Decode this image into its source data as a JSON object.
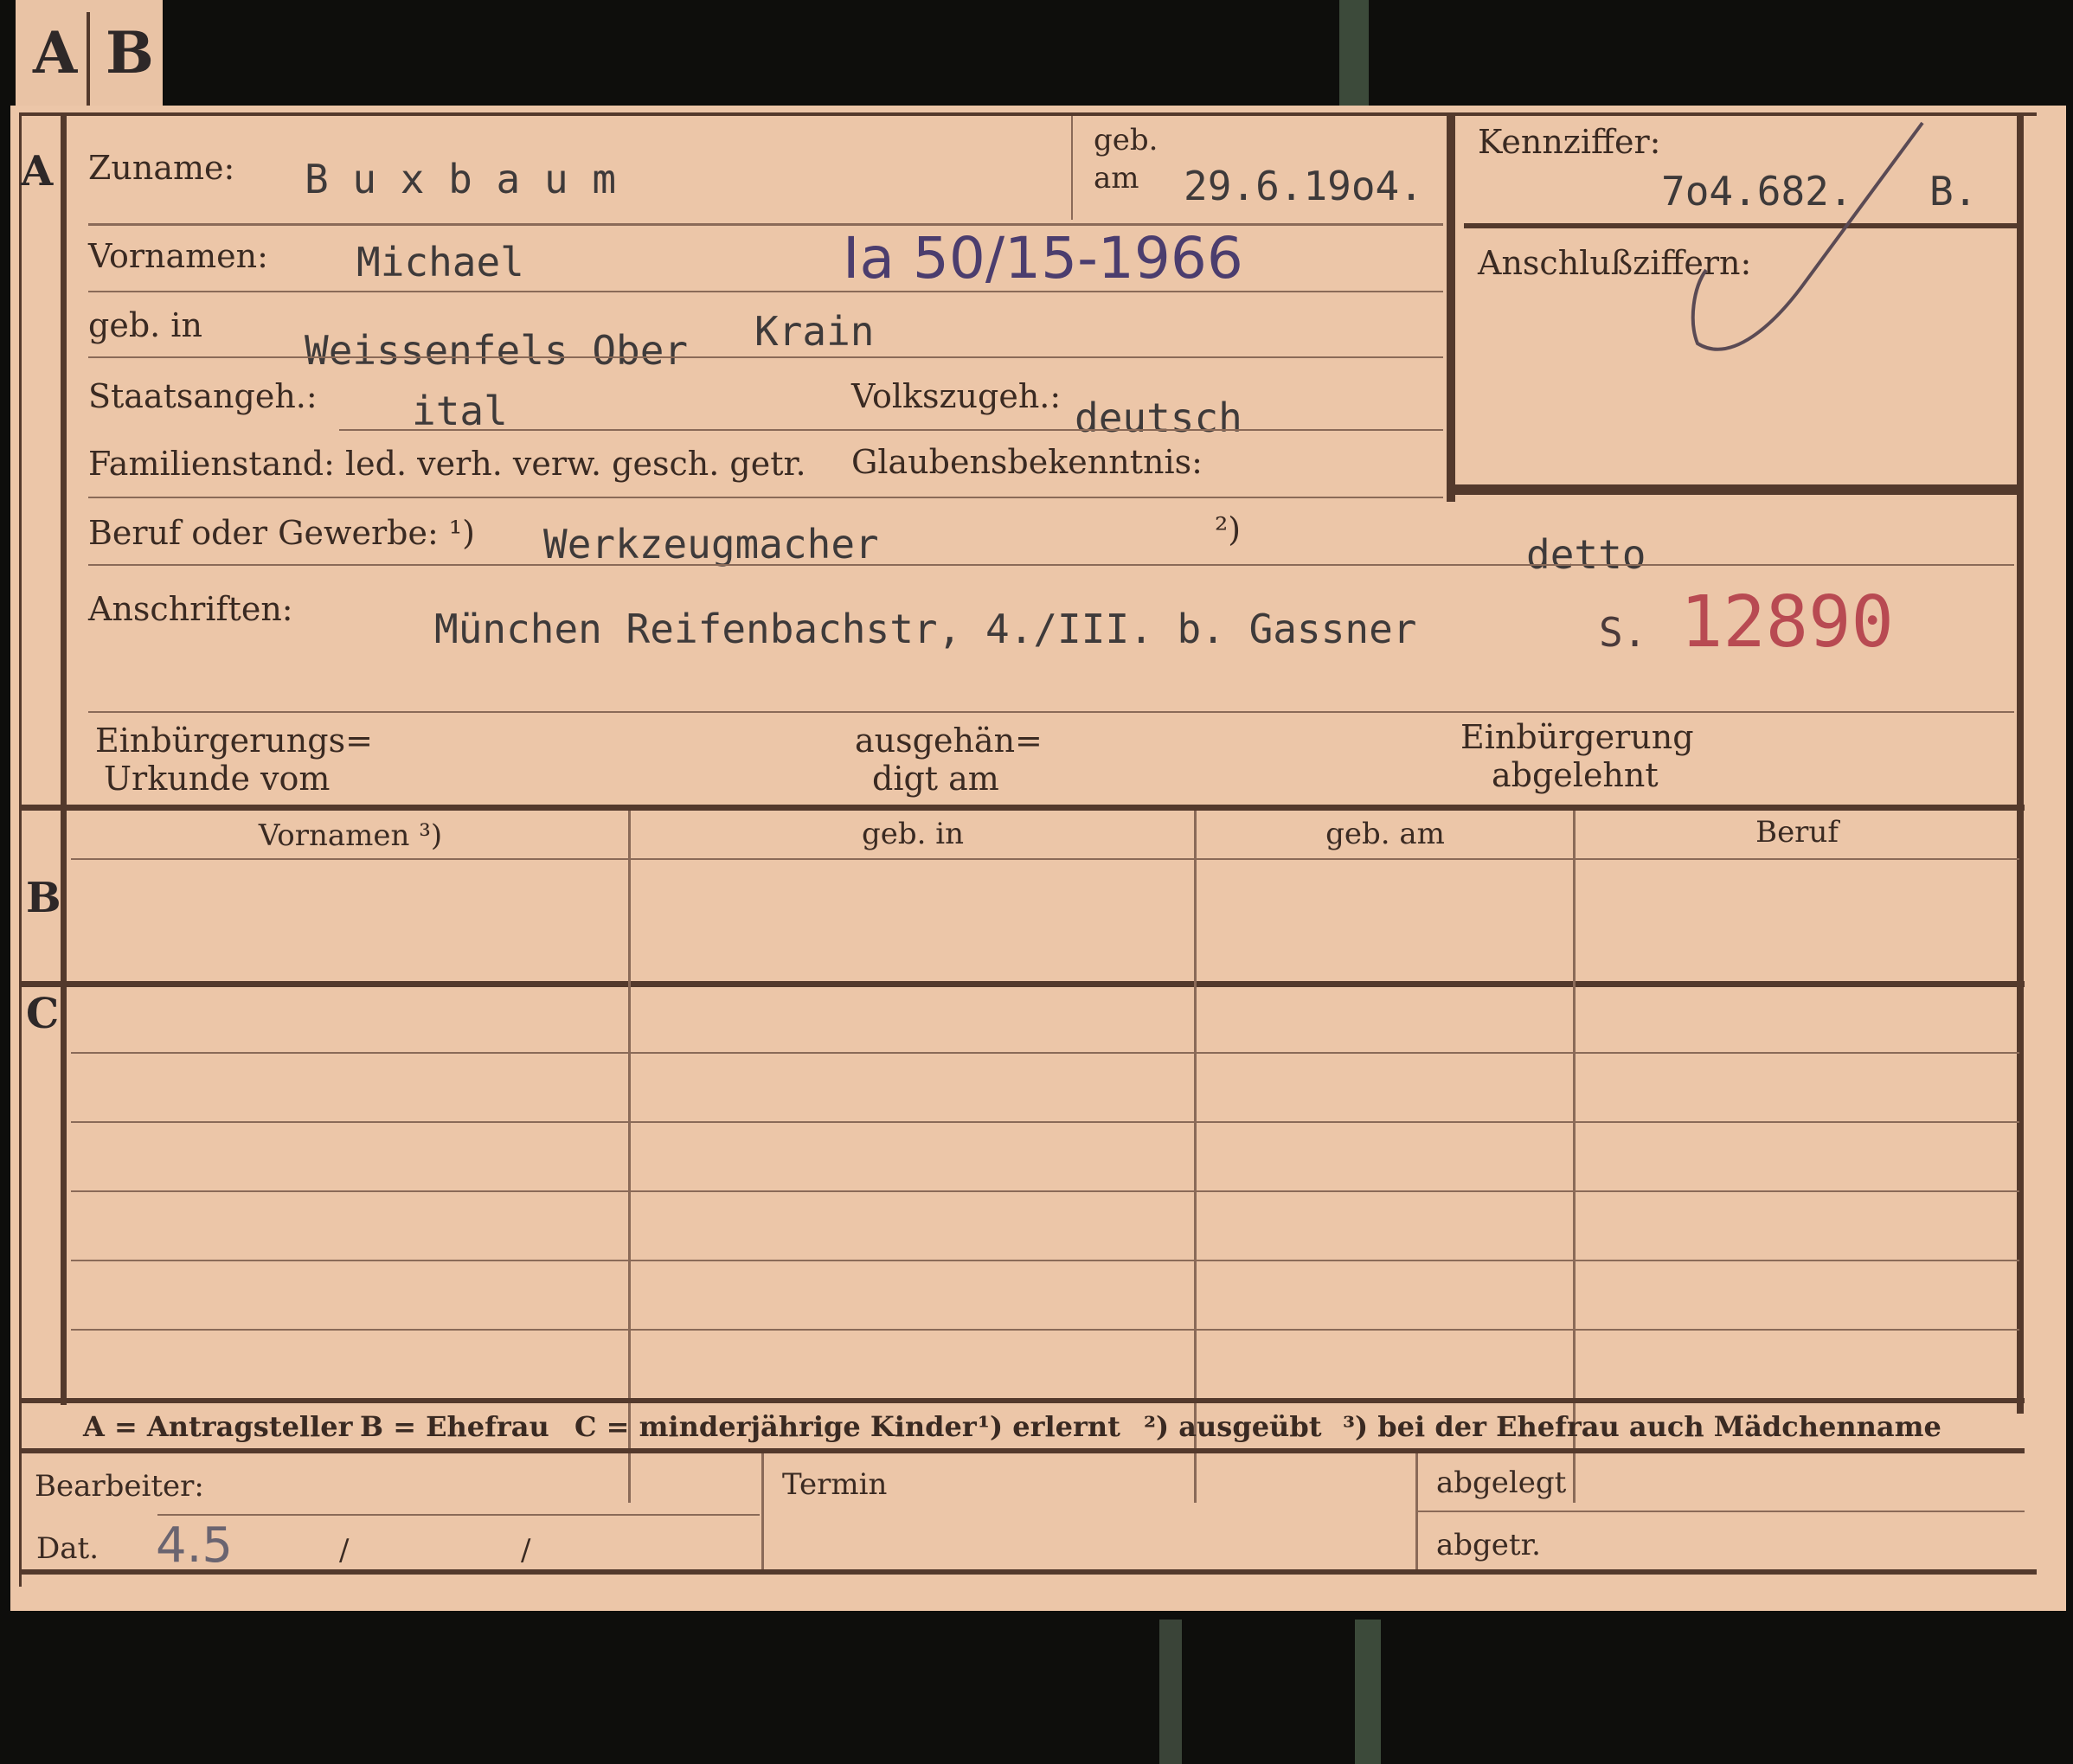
{
  "tab": {
    "a": "A",
    "b": "B"
  },
  "sections": {
    "a": "A",
    "b": "B",
    "c": "C"
  },
  "labels": {
    "zuname": "Zuname:",
    "geb": "geb.",
    "am": "am",
    "kennziffer": "Kennziffer:",
    "anschlussziffern": "Anschlußziffern:",
    "vornamen": "Vornamen:",
    "geb_in": "geb. in",
    "staatsangeh": "Staatsangeh.:",
    "volkszugeh": "Volkszugeh.:",
    "familienstand": "Familienstand: led. verh. verw. gesch. getr.",
    "glaubensbekenntnis": "Glaubensbekenntnis:",
    "beruf": "Beruf oder Gewerbe: ¹)",
    "beruf_note2": "²)",
    "anschriften": "Anschriften:",
    "einbuergerungs_line1": "Einbürgerungs=",
    "einbuergerungs_line2": "Urkunde vom",
    "ausgehaen_line1": "ausgehän=",
    "ausgehaen_line2": "digt am",
    "abgelehnt_line1": "Einbürgerung",
    "abgelehnt_line2": "abgelehnt"
  },
  "values": {
    "zuname": "B u x b a u m",
    "geb_am": "29.6.19o4.",
    "kennziffer": "7o4.682.",
    "kennziffer_suffix": "B.",
    "vornamen": "Michael",
    "aktenzeichen": "Ia 50/15-1966",
    "geb_in_1": "Weissenfels Ober",
    "geb_in_2": "Krain",
    "staatsangeh": "ital",
    "volkszugeh": "deutsch",
    "beruf": "Werkzeugmacher",
    "beruf_ausgeuebt": "detto",
    "anschrift": "München  Reifenbachstr, 4./III. b. Gassner",
    "stamp_prefix": "S.",
    "stamp_number": "12890"
  },
  "table": {
    "headers": [
      "Vornamen ³)",
      "geb. in",
      "geb. am",
      "Beruf"
    ]
  },
  "legend": {
    "a": "A = Antragsteller",
    "b": "B = Ehefrau",
    "c": "C = minderjährige Kinder",
    "n1": "¹) erlernt",
    "n2": "²) ausgeübt",
    "n3": "³) bei der Ehefrau auch Mädchenname"
  },
  "footer": {
    "bearbeiter": "Bearbeiter:",
    "dat": "Dat.",
    "dat_value": "4.5",
    "slash1": "/",
    "slash2": "/",
    "termin": "Termin",
    "abgelegt": "abgelegt",
    "abgetr": "abgetr."
  },
  "colors": {
    "card": "#ecc6a8",
    "ink": "#3a2a22",
    "rule": "#53392c",
    "stamp": "#b84a52",
    "handwriting": "#4b3d6e"
  }
}
